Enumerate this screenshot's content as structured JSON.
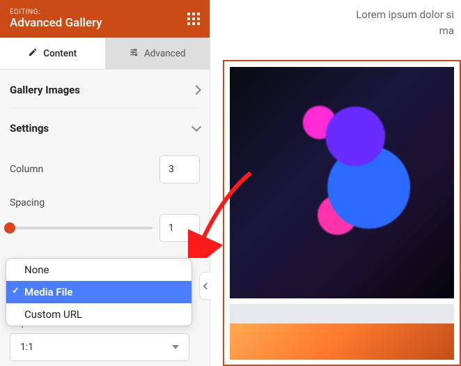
{
  "header": {
    "editing_label": "EDITING:",
    "title": "Advanced Gallery"
  },
  "tabs": {
    "content": "Content",
    "advanced": "Advanced"
  },
  "sections": {
    "gallery_images": "Gallery Images",
    "settings": "Settings"
  },
  "fields": {
    "column_label": "Column",
    "column_value": "3",
    "spacing_label": "Spacing",
    "spacing_value": "1",
    "aspect_label_fragment": "Aspect Ratio",
    "aspect_value": "1:1"
  },
  "dropdown": {
    "options": [
      "None",
      "Media File",
      "Custom URL"
    ],
    "selected": "Media File"
  },
  "canvas": {
    "lorem_line1": "Lorem ipsum dolor si",
    "lorem_line2": "ma"
  },
  "colors": {
    "accent": "#cb4b16",
    "highlight": "#4a7dff"
  }
}
